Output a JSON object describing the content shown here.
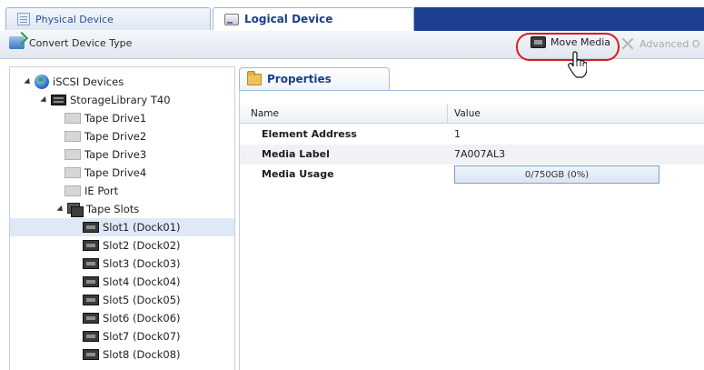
{
  "tabs": {
    "physical_label": "Physical Device",
    "logical_label": "Logical Device"
  },
  "toolbar": {
    "convert_label": "Convert Device Type",
    "move_media_label": "Move Media",
    "advanced_label": "Advanced O"
  },
  "tree": {
    "root_label": "iSCSI Devices",
    "library_label": "StorageLibrary T40",
    "drives": [
      "Tape Drive1",
      "Tape Drive2",
      "Tape Drive3",
      "Tape Drive4",
      "IE Port"
    ],
    "slots_group_label": "Tape Slots",
    "slots": [
      "Slot1 (Dock01)",
      "Slot2 (Dock02)",
      "Slot3 (Dock03)",
      "Slot4 (Dock04)",
      "Slot5 (Dock05)",
      "Slot6 (Dock06)",
      "Slot7 (Dock07)",
      "Slot8 (Dock08)"
    ],
    "selected_slot": "Slot1 (Dock01)"
  },
  "properties": {
    "tab_label": "Properties",
    "col_name": "Name",
    "col_value": "Value",
    "rows": [
      {
        "name": "Element Address",
        "value": "1"
      },
      {
        "name": "Media Label",
        "value": "7A007AL3"
      },
      {
        "name": "Media Usage",
        "value": "0/750GB (0%)"
      }
    ],
    "media_usage_fraction": 0
  },
  "colors": {
    "nav_blue": "#1d3f8f",
    "highlight_red": "#d41f1f",
    "selected_row": "#dfe8f7"
  },
  "icons": {
    "physical_tab": "document-icon",
    "logical_tab": "drive-icon",
    "convert": "convert-icon",
    "move_media": "tape-media-icon",
    "advanced": "tools-icon",
    "properties": "folder-icon",
    "cursor": "hand-pointer-icon"
  }
}
